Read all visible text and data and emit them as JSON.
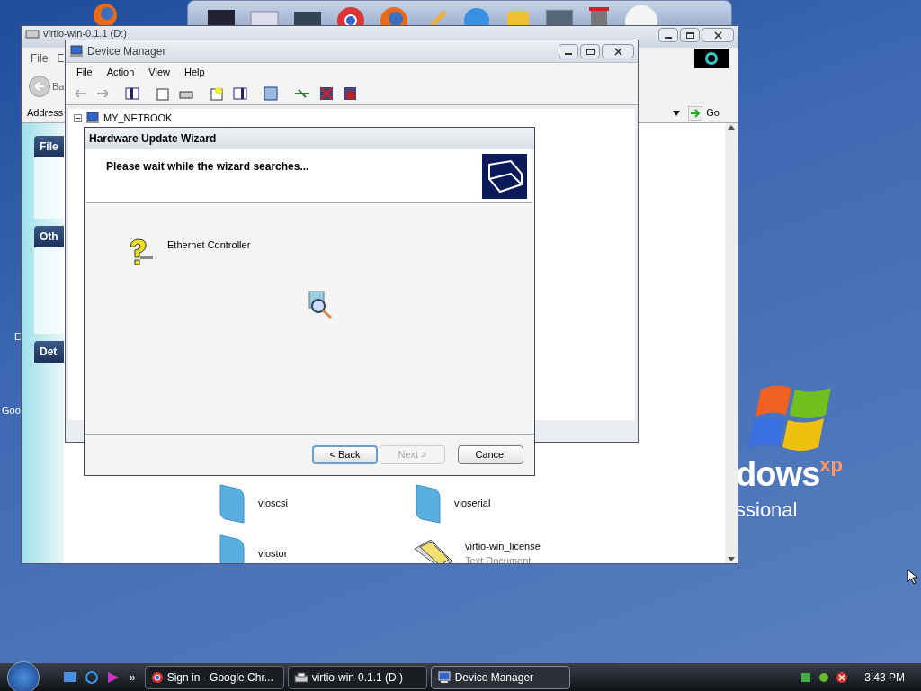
{
  "desktop": {
    "icon_labels": [
      "E",
      "Goo"
    ],
    "logo": {
      "word": "dows",
      "mark": "xp",
      "edition": "ssional"
    }
  },
  "explorer": {
    "title": "virtio-win-0.1.1 (D:)",
    "menu": [
      "File",
      "E"
    ],
    "back_label": "Ba",
    "address_label": "Address",
    "go": "Go",
    "task_groups": [
      "File",
      "Oth",
      "Det"
    ],
    "files": [
      {
        "name": "vioscsi",
        "kind": "folder"
      },
      {
        "name": "vioserial",
        "kind": "folder"
      },
      {
        "name": "viostor",
        "kind": "folder"
      },
      {
        "name": "virtio-win_license",
        "kind": "text",
        "detail": "Text Document"
      }
    ]
  },
  "device_manager": {
    "title": "Device Manager",
    "menu": [
      "File",
      "Action",
      "View",
      "Help"
    ],
    "tree": [
      {
        "label": "MY_NETBOOK",
        "expanded": true
      }
    ]
  },
  "wizard": {
    "title": "Hardware Update Wizard",
    "heading": "Please wait while the wizard searches...",
    "device": "Ethernet Controller",
    "buttons": [
      {
        "label": "< Back",
        "disabled": false,
        "default": true
      },
      {
        "label": "Next >",
        "disabled": true,
        "default": false
      },
      {
        "label": "Cancel",
        "disabled": false,
        "default": false
      }
    ]
  },
  "taskbar": {
    "chevron": "»",
    "tasks": [
      {
        "label": "Sign in - Google Chr...",
        "kind": "browser",
        "selected": false
      },
      {
        "label": "virtio-win-0.1.1 (D:)",
        "kind": "drive",
        "selected": false
      },
      {
        "label": "Device Manager",
        "kind": "computer",
        "selected": true
      }
    ],
    "clock": "3:43 PM"
  }
}
